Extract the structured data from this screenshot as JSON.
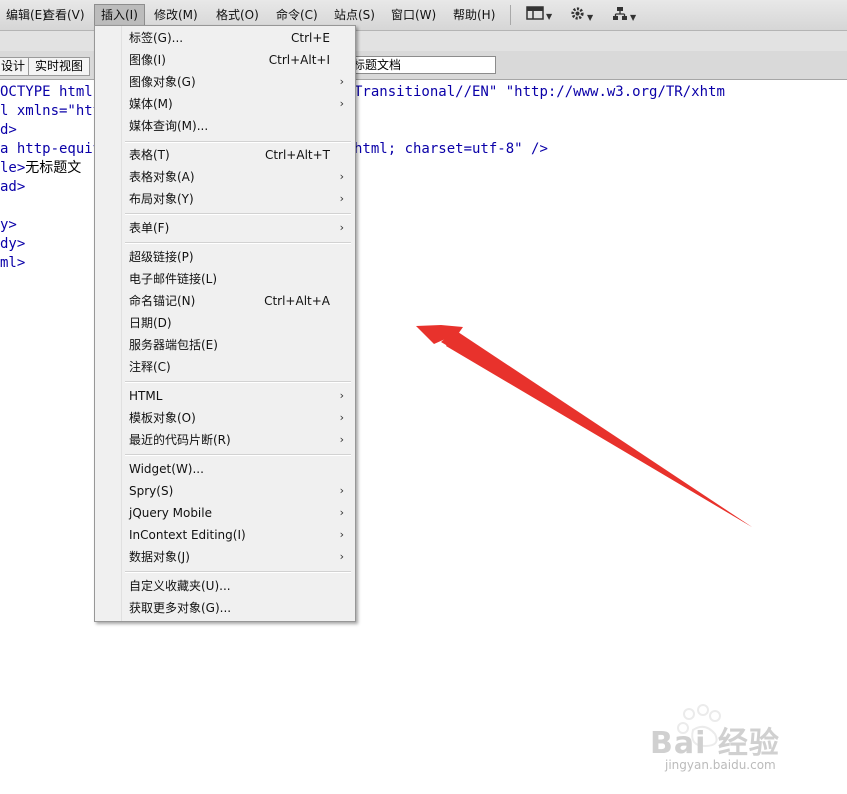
{
  "menubar": {
    "items": [
      "编辑(E)",
      "查看(V)",
      "插入(I)",
      "修改(M)",
      "格式(O)",
      "命令(C)",
      "站点(S)",
      "窗口(W)",
      "帮助(H)"
    ],
    "icons": [
      "layout-icon",
      "gear-icon",
      "site-icon"
    ]
  },
  "toolbar": {
    "design_label": "设计",
    "live_view_label": "实时视图",
    "title_value": "标题文档"
  },
  "code_lines": [
    "OCTYPE html PUBLIC \"-//W3C//DTD XHTML 1.0 Transitional//EN\" \"http://www.w3.org/TR/xhtm",
    "l xmlns=\"http://www.w3.org/1999/xhtml\">",
    "d>",
    "a http-equiv=\"Content-Type\" content=\"text/html; charset=utf-8\" />",
    "le>",
    "ad>",
    "",
    "y>",
    "dy>",
    "ml>"
  ],
  "code_title_text": "无标题文",
  "insert_menu": {
    "items": [
      {
        "label": "标签(G)...",
        "shortcut": "Ctrl+E",
        "submenu": false
      },
      {
        "label": "图像(I)",
        "shortcut": "Ctrl+Alt+I",
        "submenu": false
      },
      {
        "label": "图像对象(G)",
        "shortcut": "",
        "submenu": true
      },
      {
        "label": "媒体(M)",
        "shortcut": "",
        "submenu": true
      },
      {
        "label": "媒体查询(M)...",
        "shortcut": "",
        "submenu": false
      },
      {
        "label": "表格(T)",
        "shortcut": "Ctrl+Alt+T",
        "submenu": false
      },
      {
        "label": "表格对象(A)",
        "shortcut": "",
        "submenu": true
      },
      {
        "label": "布局对象(Y)",
        "shortcut": "",
        "submenu": true
      },
      {
        "label": "表单(F)",
        "shortcut": "",
        "submenu": true
      },
      {
        "label": "超级链接(P)",
        "shortcut": "",
        "submenu": false
      },
      {
        "label": "电子邮件链接(L)",
        "shortcut": "",
        "submenu": false
      },
      {
        "label": "命名锚记(N)",
        "shortcut": "Ctrl+Alt+A",
        "submenu": false
      },
      {
        "label": "日期(D)",
        "shortcut": "",
        "submenu": false
      },
      {
        "label": "服务器端包括(E)",
        "shortcut": "",
        "submenu": false
      },
      {
        "label": "注释(C)",
        "shortcut": "",
        "submenu": false
      },
      {
        "label": "HTML",
        "shortcut": "",
        "submenu": true
      },
      {
        "label": "模板对象(O)",
        "shortcut": "",
        "submenu": true
      },
      {
        "label": "最近的代码片断(R)",
        "shortcut": "",
        "submenu": true
      },
      {
        "label": "Widget(W)...",
        "shortcut": "",
        "submenu": false
      },
      {
        "label": "Spry(S)",
        "shortcut": "",
        "submenu": true
      },
      {
        "label": "jQuery Mobile",
        "shortcut": "",
        "submenu": true
      },
      {
        "label": "InContext Editing(I)",
        "shortcut": "",
        "submenu": true
      },
      {
        "label": "数据对象(J)",
        "shortcut": "",
        "submenu": true
      },
      {
        "label": "自定义收藏夹(U)...",
        "shortcut": "",
        "submenu": false
      },
      {
        "label": "获取更多对象(G)...",
        "shortcut": "",
        "submenu": false
      }
    ],
    "submenu_glyph": "›"
  },
  "watermark": {
    "brand": "Bai 经验",
    "url": "jingyan.baidu.com"
  },
  "colors": {
    "code_text": "#0a00a8",
    "arrow": "#e8322c"
  }
}
